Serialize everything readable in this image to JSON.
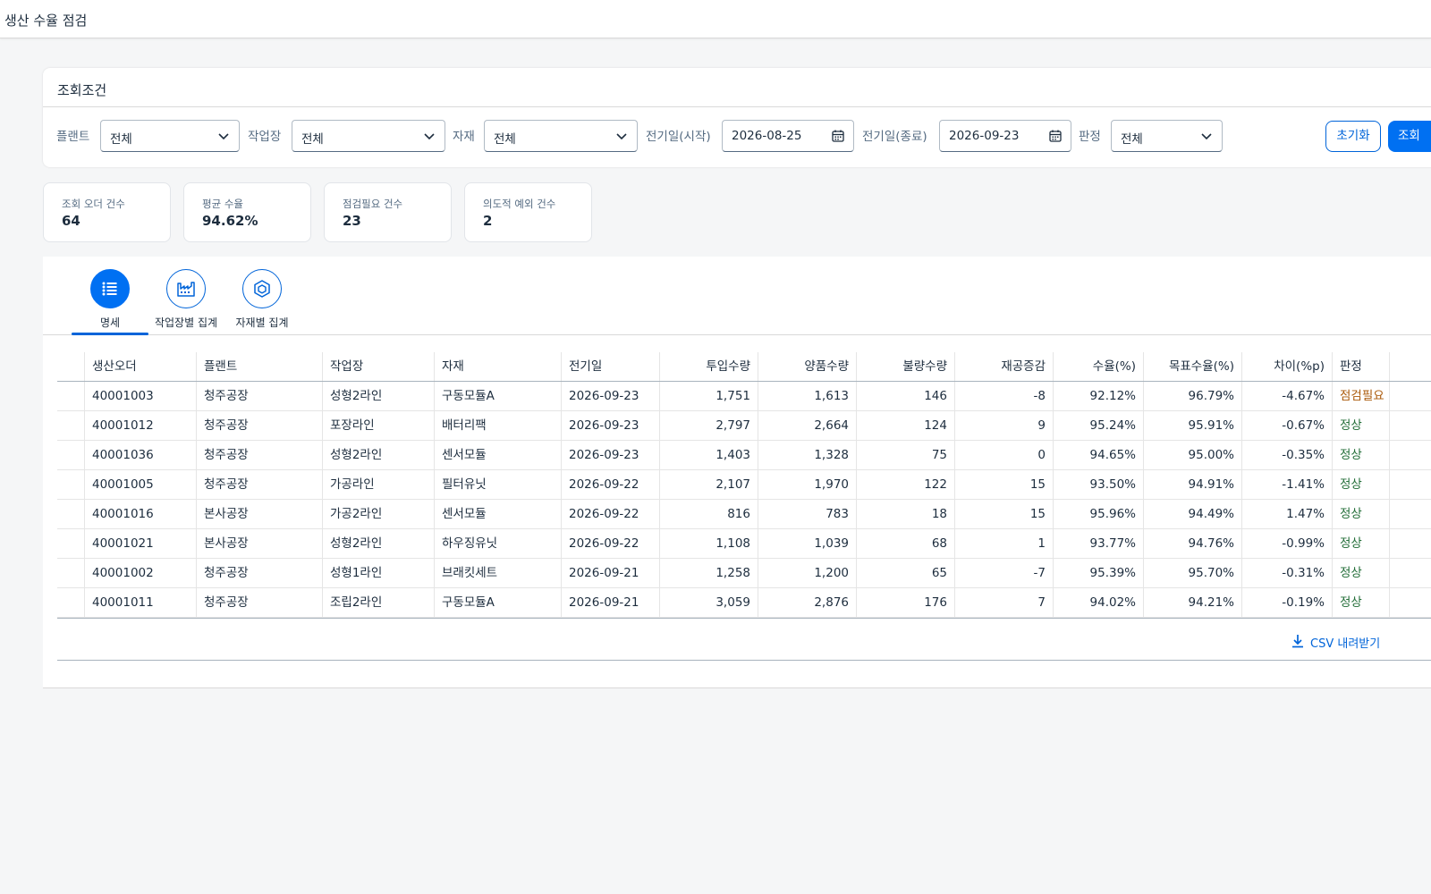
{
  "app": {
    "title": "생산 수율 점검"
  },
  "filters": {
    "panel_title": "조회조건",
    "plant": {
      "label": "플랜트",
      "value": "전체"
    },
    "workcenter": {
      "label": "작업장",
      "value": "전체"
    },
    "material": {
      "label": "자재",
      "value": "전체"
    },
    "date_from": {
      "label": "전기일(시작)",
      "value": "2026-08-25"
    },
    "date_to": {
      "label": "전기일(종료)",
      "value": "2026-09-23"
    },
    "judgement": {
      "label": "판정",
      "value": "전체"
    },
    "reset_label": "초기화",
    "search_label": "조회"
  },
  "kpis": [
    {
      "label": "조회 오더 건수",
      "value": "64"
    },
    {
      "label": "평균 수율",
      "value": "94.62%"
    },
    {
      "label": "점검필요 건수",
      "value": "23"
    },
    {
      "label": "의도적 예외 건수",
      "value": "2"
    }
  ],
  "tabs": [
    {
      "label": "명세",
      "icon": "list-icon",
      "active": true
    },
    {
      "label": "작업장별 집계",
      "icon": "factory-icon",
      "active": false
    },
    {
      "label": "자재별 집계",
      "icon": "material-icon",
      "active": false
    }
  ],
  "table": {
    "columns": [
      "생산오더",
      "플랜트",
      "작업장",
      "자재",
      "전기일",
      "투입수량",
      "양품수량",
      "불량수량",
      "재공증감",
      "수율(%)",
      "목표수율(%)",
      "차이(%p)",
      "판정"
    ],
    "rows": [
      [
        "40001003",
        "청주공장",
        "성형2라인",
        "구동모듈A",
        "2026-09-23",
        "1,751",
        "1,613",
        "146",
        "-8",
        "92.12%",
        "96.79%",
        "-4.67%",
        "점검필요"
      ],
      [
        "40001012",
        "청주공장",
        "포장라인",
        "배터리팩",
        "2026-09-23",
        "2,797",
        "2,664",
        "124",
        "9",
        "95.24%",
        "95.91%",
        "-0.67%",
        "정상"
      ],
      [
        "40001036",
        "청주공장",
        "성형2라인",
        "센서모듈",
        "2026-09-23",
        "1,403",
        "1,328",
        "75",
        "0",
        "94.65%",
        "95.00%",
        "-0.35%",
        "정상"
      ],
      [
        "40001005",
        "청주공장",
        "가공라인",
        "필터유닛",
        "2026-09-22",
        "2,107",
        "1,970",
        "122",
        "15",
        "93.50%",
        "94.91%",
        "-1.41%",
        "정상"
      ],
      [
        "40001016",
        "본사공장",
        "가공2라인",
        "센서모듈",
        "2026-09-22",
        "816",
        "783",
        "18",
        "15",
        "95.96%",
        "94.49%",
        "1.47%",
        "정상"
      ],
      [
        "40001021",
        "본사공장",
        "성형2라인",
        "하우징유닛",
        "2026-09-22",
        "1,108",
        "1,039",
        "68",
        "1",
        "93.77%",
        "94.76%",
        "-0.99%",
        "정상"
      ],
      [
        "40001002",
        "청주공장",
        "성형1라인",
        "브래킷세트",
        "2026-09-21",
        "1,258",
        "1,200",
        "65",
        "-7",
        "95.39%",
        "95.70%",
        "-0.31%",
        "정상"
      ],
      [
        "40001011",
        "청주공장",
        "조립2라인",
        "구동모듈A",
        "2026-09-21",
        "3,059",
        "2,876",
        "176",
        "7",
        "94.02%",
        "94.21%",
        "-0.19%",
        "정상"
      ]
    ]
  },
  "csv_label": "CSV 내려받기",
  "colors": {
    "accent": "#0070f2",
    "warning": "#aa5808",
    "success": "#256f3a"
  }
}
